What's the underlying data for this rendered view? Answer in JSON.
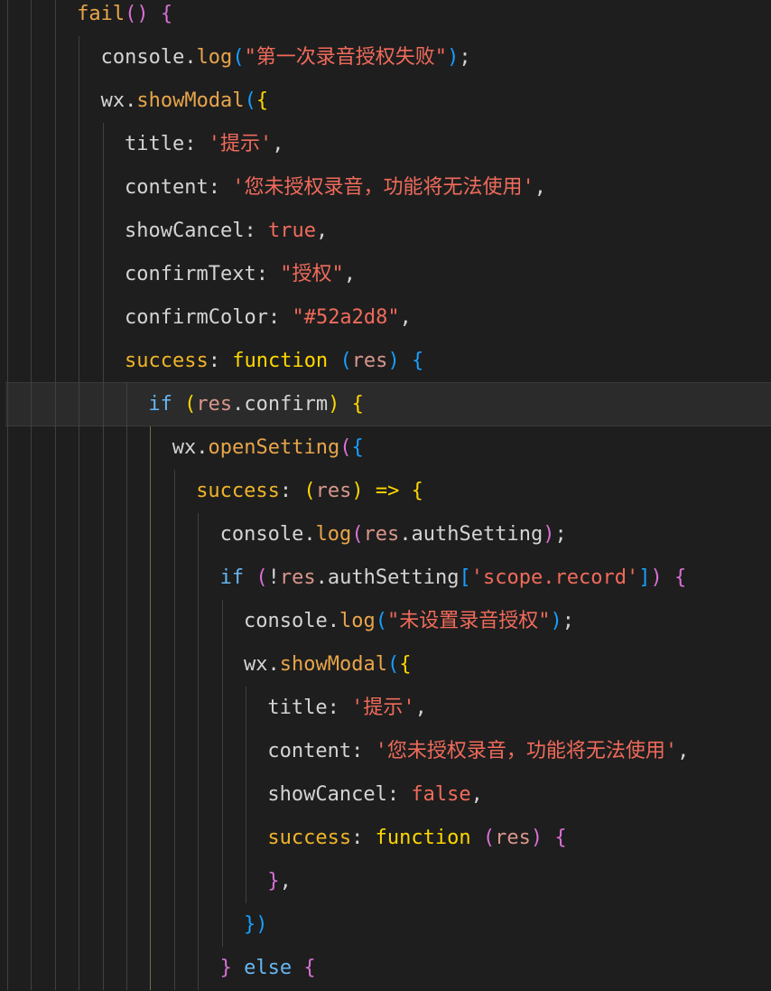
{
  "editor": {
    "lines": [
      {
        "indent": 3,
        "tokens": [
          [
            "fail",
            "fn"
          ],
          [
            "(",
            "p2"
          ],
          [
            ")",
            "p2"
          ],
          [
            " ",
            "plain"
          ],
          [
            "{",
            "p2"
          ]
        ]
      },
      {
        "indent": 4,
        "tokens": [
          [
            "console",
            "plain"
          ],
          [
            ".",
            "plain"
          ],
          [
            "log",
            "fn"
          ],
          [
            "(",
            "p3"
          ],
          [
            "\"第一次录音授权失败\"",
            "str"
          ],
          [
            ")",
            "p3"
          ],
          [
            ";",
            "plain"
          ]
        ]
      },
      {
        "indent": 4,
        "tokens": [
          [
            "wx",
            "plain"
          ],
          [
            ".",
            "plain"
          ],
          [
            "showModal",
            "fn"
          ],
          [
            "(",
            "p3"
          ],
          [
            "{",
            "p1"
          ]
        ]
      },
      {
        "indent": 5,
        "tokens": [
          [
            "title",
            "plain"
          ],
          [
            ": ",
            "plain"
          ],
          [
            "'提示'",
            "str"
          ],
          [
            ",",
            "plain"
          ]
        ]
      },
      {
        "indent": 5,
        "tokens": [
          [
            "content",
            "plain"
          ],
          [
            ": ",
            "plain"
          ],
          [
            "'您未授权录音，功能将无法使用'",
            "str"
          ],
          [
            ",",
            "plain"
          ]
        ]
      },
      {
        "indent": 5,
        "tokens": [
          [
            "showCancel",
            "plain"
          ],
          [
            ": ",
            "plain"
          ],
          [
            "true",
            "kw"
          ],
          [
            ",",
            "plain"
          ]
        ]
      },
      {
        "indent": 5,
        "tokens": [
          [
            "confirmText",
            "plain"
          ],
          [
            ": ",
            "plain"
          ],
          [
            "\"授权\"",
            "str"
          ],
          [
            ",",
            "plain"
          ]
        ]
      },
      {
        "indent": 5,
        "tokens": [
          [
            "confirmColor",
            "plain"
          ],
          [
            ": ",
            "plain"
          ],
          [
            "\"#52a2d8\"",
            "str"
          ],
          [
            ",",
            "plain"
          ]
        ]
      },
      {
        "indent": 5,
        "tokens": [
          [
            "success",
            "prop"
          ],
          [
            ": ",
            "plain"
          ],
          [
            "function",
            "p1"
          ],
          [
            " ",
            "plain"
          ],
          [
            "(",
            "p3"
          ],
          [
            "res",
            "var"
          ],
          [
            ")",
            "p3"
          ],
          [
            " ",
            "plain"
          ],
          [
            "{",
            "p3"
          ]
        ]
      },
      {
        "indent": 6,
        "tokens": [
          [
            "if",
            "kw2"
          ],
          [
            " ",
            "plain"
          ],
          [
            "(",
            "p1"
          ],
          [
            "res",
            "var"
          ],
          [
            ".confirm",
            "plain"
          ],
          [
            ")",
            "p1"
          ],
          [
            " ",
            "plain"
          ],
          [
            "{",
            "p1"
          ]
        ]
      },
      {
        "indent": 7,
        "tokens": [
          [
            "wx",
            "plain"
          ],
          [
            ".",
            "plain"
          ],
          [
            "openSetting",
            "fn"
          ],
          [
            "(",
            "p2"
          ],
          [
            "{",
            "p3"
          ]
        ]
      },
      {
        "indent": 8,
        "tokens": [
          [
            "success",
            "prop"
          ],
          [
            ": ",
            "plain"
          ],
          [
            "(",
            "p1"
          ],
          [
            "res",
            "var"
          ],
          [
            ")",
            "p1"
          ],
          [
            " ",
            "plain"
          ],
          [
            "=>",
            "p1"
          ],
          [
            " ",
            "plain"
          ],
          [
            "{",
            "p1"
          ]
        ]
      },
      {
        "indent": 9,
        "tokens": [
          [
            "console",
            "plain"
          ],
          [
            ".",
            "plain"
          ],
          [
            "log",
            "fn"
          ],
          [
            "(",
            "p2"
          ],
          [
            "res",
            "var"
          ],
          [
            ".authSetting",
            "plain"
          ],
          [
            ")",
            "p2"
          ],
          [
            ";",
            "plain"
          ]
        ]
      },
      {
        "indent": 9,
        "tokens": [
          [
            "if",
            "kw2"
          ],
          [
            " ",
            "plain"
          ],
          [
            "(",
            "p2"
          ],
          [
            "!",
            "plain"
          ],
          [
            "res",
            "var"
          ],
          [
            ".authSetting",
            "plain"
          ],
          [
            "[",
            "p3"
          ],
          [
            "'scope.record'",
            "str"
          ],
          [
            "]",
            "p3"
          ],
          [
            ")",
            "p2"
          ],
          [
            " ",
            "plain"
          ],
          [
            "{",
            "p2"
          ]
        ]
      },
      {
        "indent": 10,
        "tokens": [
          [
            "console",
            "plain"
          ],
          [
            ".",
            "plain"
          ],
          [
            "log",
            "fn"
          ],
          [
            "(",
            "p3"
          ],
          [
            "\"未设置录音授权\"",
            "str"
          ],
          [
            ")",
            "p3"
          ],
          [
            ";",
            "plain"
          ]
        ]
      },
      {
        "indent": 10,
        "tokens": [
          [
            "wx",
            "plain"
          ],
          [
            ".",
            "plain"
          ],
          [
            "showModal",
            "fn"
          ],
          [
            "(",
            "p3"
          ],
          [
            "{",
            "p1"
          ]
        ]
      },
      {
        "indent": 11,
        "tokens": [
          [
            "title",
            "plain"
          ],
          [
            ": ",
            "plain"
          ],
          [
            "'提示'",
            "str"
          ],
          [
            ",",
            "plain"
          ]
        ]
      },
      {
        "indent": 11,
        "tokens": [
          [
            "content",
            "plain"
          ],
          [
            ": ",
            "plain"
          ],
          [
            "'您未授权录音，功能将无法使用'",
            "str"
          ],
          [
            ",",
            "plain"
          ]
        ]
      },
      {
        "indent": 11,
        "tokens": [
          [
            "showCancel",
            "plain"
          ],
          [
            ": ",
            "plain"
          ],
          [
            "false",
            "kw"
          ],
          [
            ",",
            "plain"
          ]
        ]
      },
      {
        "indent": 11,
        "tokens": [
          [
            "success",
            "prop"
          ],
          [
            ": ",
            "plain"
          ],
          [
            "function",
            "p1"
          ],
          [
            " ",
            "plain"
          ],
          [
            "(",
            "p2"
          ],
          [
            "res",
            "var"
          ],
          [
            ")",
            "p2"
          ],
          [
            " ",
            "plain"
          ],
          [
            "{",
            "p2"
          ]
        ]
      },
      {
        "indent": 11,
        "tokens": [
          [
            "}",
            "p2"
          ],
          [
            ",",
            "plain"
          ]
        ]
      },
      {
        "indent": 10,
        "tokens": [
          [
            "})",
            "p3"
          ]
        ]
      },
      {
        "indent": 9,
        "tokens": [
          [
            "}",
            "p2"
          ],
          [
            " ",
            "plain"
          ],
          [
            "else",
            "kw2"
          ],
          [
            " ",
            "plain"
          ],
          [
            "{",
            "p2"
          ]
        ]
      }
    ]
  }
}
